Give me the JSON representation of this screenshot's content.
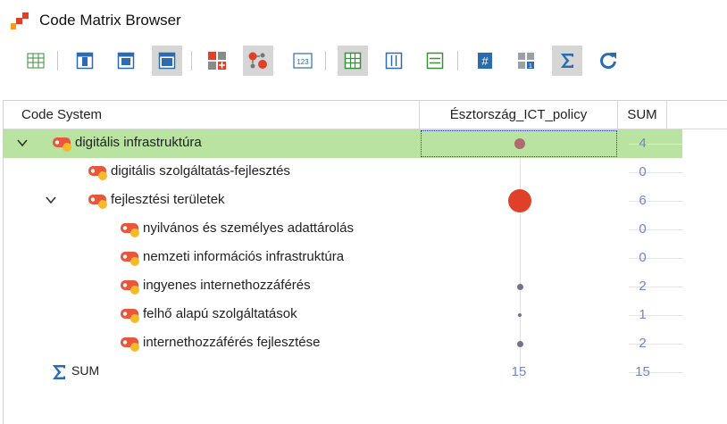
{
  "window": {
    "title": "Code Matrix Browser"
  },
  "toolbar": {
    "buttons": [
      {
        "icon": "table-grid-icon",
        "active": false
      },
      {
        "icon": "panel-left-icon",
        "active": false
      },
      {
        "icon": "panel-right-icon",
        "active": false
      },
      {
        "icon": "panel-full-icon",
        "active": true
      },
      {
        "icon": "codes-in-documents-icon",
        "active": false
      },
      {
        "icon": "codes-nodes-icon",
        "active": true
      },
      {
        "icon": "numbers-icon",
        "active": false,
        "text": "123"
      },
      {
        "icon": "grid-view-icon",
        "active": true
      },
      {
        "icon": "columns-view-icon",
        "active": false
      },
      {
        "icon": "rows-view-icon",
        "active": false
      },
      {
        "icon": "hash-icon",
        "active": false
      },
      {
        "icon": "binary-icon",
        "active": false
      },
      {
        "icon": "sigma-icon",
        "active": true
      },
      {
        "icon": "refresh-icon",
        "active": false
      }
    ]
  },
  "grid": {
    "headers": {
      "code_system": "Code System",
      "document": "Észtország_ICT_policy",
      "sum": "SUM"
    },
    "rows": [
      {
        "label": "digitális infrastruktúra",
        "level": 0,
        "expanded": true,
        "selected": true,
        "doc": 4,
        "sum": "4"
      },
      {
        "label": "digitális szolgáltatás-fejlesztés",
        "level": 1,
        "expanded": null,
        "selected": false,
        "doc": 0,
        "sum": "0"
      },
      {
        "label": "fejlesztési területek",
        "level": 1,
        "expanded": true,
        "selected": false,
        "doc": 6,
        "sum": "6"
      },
      {
        "label": "nyilvános és személyes adattárolás",
        "level": 2,
        "expanded": null,
        "selected": false,
        "doc": 0,
        "sum": "0"
      },
      {
        "label": "nemzeti információs infrastruktúra",
        "level": 2,
        "expanded": null,
        "selected": false,
        "doc": 0,
        "sum": "0"
      },
      {
        "label": "ingyenes internethozzáférés",
        "level": 2,
        "expanded": null,
        "selected": false,
        "doc": 2,
        "sum": "2"
      },
      {
        "label": "felhő alapú szolgáltatások",
        "level": 2,
        "expanded": null,
        "selected": false,
        "doc": 1,
        "sum": "1"
      },
      {
        "label": "internethozzáférés fejlesztése",
        "level": 2,
        "expanded": null,
        "selected": false,
        "doc": 2,
        "sum": "2"
      }
    ],
    "sum_row": {
      "label": "SUM",
      "doc": "15",
      "sum": "15"
    }
  },
  "colors": {
    "selected_row": "#b9e3a0",
    "sum_text": "#6f86c8",
    "dot_large": "#e0402a",
    "dot_small": "#6f7591",
    "dot_selected": "#b06a70",
    "code_icon": "#e8573c",
    "code_icon_accent": "#f6b92b"
  }
}
